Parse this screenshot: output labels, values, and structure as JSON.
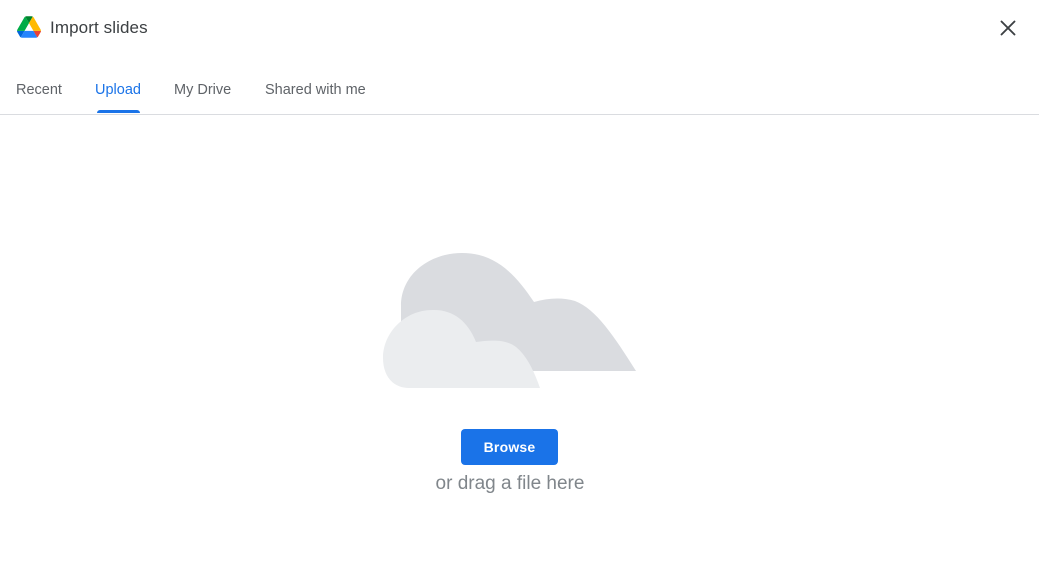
{
  "dialog": {
    "title": "Import slides",
    "close_icon": "close-icon",
    "logo_icon": "google-drive-logo-icon"
  },
  "tabs": [
    {
      "label": "Recent",
      "active": false
    },
    {
      "label": "Upload",
      "active": true
    },
    {
      "label": "My Drive",
      "active": false
    },
    {
      "label": "Shared with me",
      "active": false
    }
  ],
  "upload": {
    "illustration_icon": "cloud-icon",
    "browse_label": "Browse",
    "drag_hint": "or drag a file here"
  },
  "colors": {
    "accent": "#1a73e8",
    "tab_text": "#5f6368",
    "hint_text": "#80868b",
    "divider": "#dadce0",
    "cloud_back": "#dadce0",
    "cloud_front": "#ebedef"
  }
}
